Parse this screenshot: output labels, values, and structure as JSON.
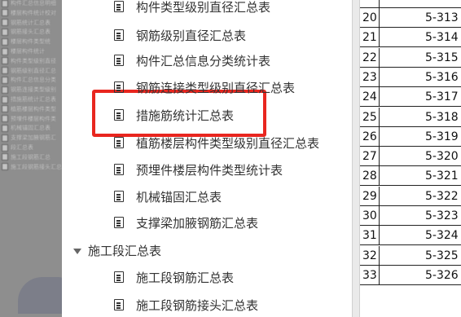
{
  "left_panel": {
    "items": [
      "构件汇总信息明细",
      "楼层构件统计校对",
      "钢筋统计汇总表",
      "钢筋接头汇总表",
      "楼层构件类型统",
      "楼层构件统计",
      "构件类型级别直径",
      "钢筋级别直径汇总",
      "构件汇总信息分类",
      "钢筋连接类型级别",
      "措施筋统计汇总表",
      "植筋楼层构件类型",
      "预埋件楼层构件类",
      "机械锚固汇总表",
      "支撑梁加腋钢筋汇",
      "段汇总表",
      "施工段钢筋汇总",
      "施工段钢筋接头汇总"
    ]
  },
  "tree": {
    "items": [
      "构件类型级别直径汇总表",
      "钢筋级别直径汇总表",
      "构件汇总信息分类统计表",
      "钢筋连接类型级别直径汇总表",
      "措施筋统计汇总表",
      "植筋楼层构件类型级别直径汇总表",
      "预埋件楼层构件类型统计表",
      "机械锚固汇总表",
      "支撑梁加腋钢筋汇总表"
    ],
    "group_label": "施工段汇总表",
    "sub_items": [
      "施工段钢筋汇总表",
      "施工段钢筋接头汇总表"
    ]
  },
  "table": {
    "rows": [
      {
        "idx": "20",
        "code": "5-313"
      },
      {
        "idx": "21",
        "code": "5-314"
      },
      {
        "idx": "22",
        "code": "5-315"
      },
      {
        "idx": "23",
        "code": "5-316"
      },
      {
        "idx": "24",
        "code": "5-317"
      },
      {
        "idx": "25",
        "code": "5-318"
      },
      {
        "idx": "26",
        "code": "5-319"
      },
      {
        "idx": "27",
        "code": "5-320"
      },
      {
        "idx": "28",
        "code": "5-321"
      },
      {
        "idx": "29",
        "code": "5-322"
      },
      {
        "idx": "30",
        "code": "5-323"
      },
      {
        "idx": "31",
        "code": "5-324"
      },
      {
        "idx": "32",
        "code": "5-325"
      },
      {
        "idx": "33",
        "code": "5-326"
      }
    ]
  },
  "colors": {
    "highlight": "#e8261f",
    "text": "#333333"
  }
}
